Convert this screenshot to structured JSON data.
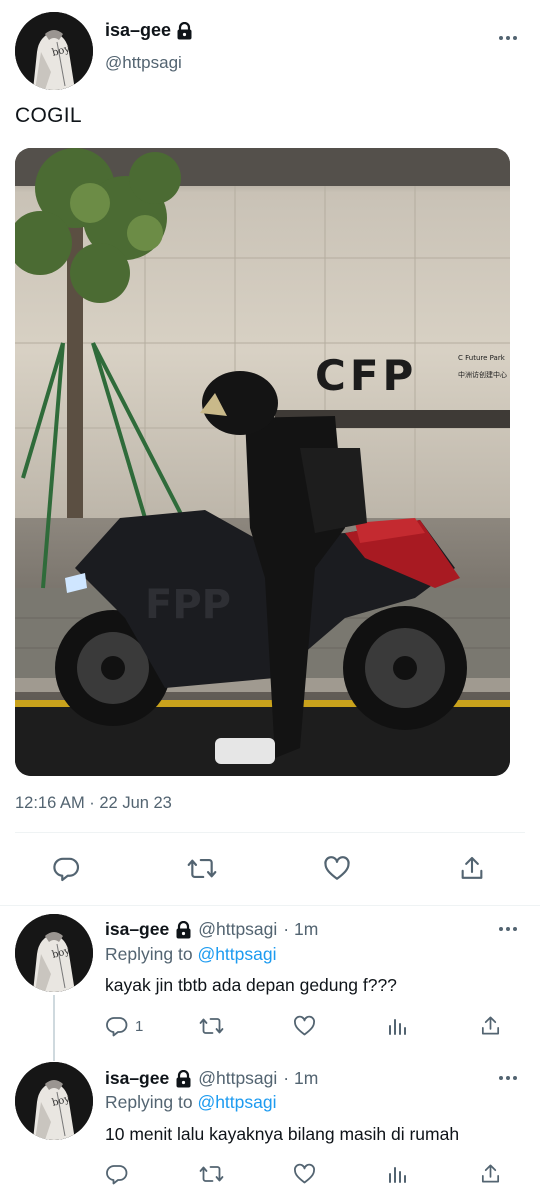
{
  "tweet": {
    "author_name": "isa–gee",
    "author_handle": "@httpsagi",
    "text": "COGIL",
    "timestamp": "12:16 AM · 22 Jun 23",
    "icons": [
      "lock-icon",
      "more-icon"
    ],
    "photo": {
      "sign_text": "CFP",
      "sign_small_line1": "C Future Park",
      "sign_small_line2": "中洲访创建中心",
      "bike_text": "FPP"
    }
  },
  "action_bar": {
    "icons": [
      "reply-icon",
      "retweet-icon",
      "like-icon",
      "share-icon"
    ]
  },
  "replies": [
    {
      "author_name": "isa–gee",
      "author_handle": "@httpsagi",
      "time": "· 1m",
      "replying_prefix": "Replying to",
      "replying_mention": "@httpsagi",
      "text": "kayak jin tbtb ada depan gedung f???",
      "reply_count": "1"
    },
    {
      "author_name": "isa–gee",
      "author_handle": "@httpsagi",
      "time": "· 1m",
      "replying_prefix": "Replying to",
      "replying_mention": "@httpsagi",
      "text": "10 menit lalu kayaknya bilang masih di rumah",
      "reply_count": ""
    }
  ],
  "colors": {
    "text": "#0f1419",
    "secondary": "#536471",
    "link": "#1d9bf0",
    "divider": "#eff3f4"
  }
}
